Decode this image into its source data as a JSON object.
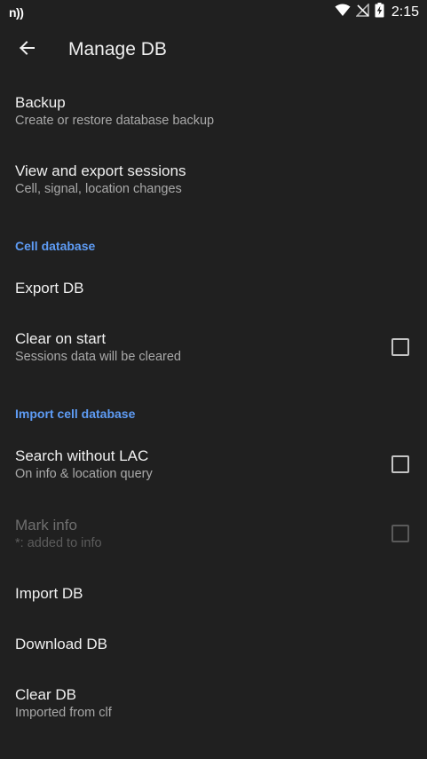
{
  "status_bar": {
    "carrier_glyph": "n))",
    "time": "2:15",
    "icons": [
      "wifi-icon",
      "no-signal-icon",
      "battery-charging-icon"
    ]
  },
  "app_bar": {
    "back_icon": "arrow-back-icon",
    "title": "Manage DB"
  },
  "items": {
    "backup": {
      "title": "Backup",
      "subtitle": "Create or restore database backup"
    },
    "sessions": {
      "title": "View and export sessions",
      "subtitle": "Cell, signal, location changes"
    },
    "export_db": {
      "title": "Export DB"
    },
    "clear_on_start": {
      "title": "Clear on start",
      "subtitle": "Sessions data will be cleared",
      "checked": false
    },
    "search_without_lac": {
      "title": "Search without LAC",
      "subtitle": "On info & location query",
      "checked": false
    },
    "mark_info": {
      "title": "Mark info",
      "subtitle": "*: added to info",
      "checked": false,
      "enabled": false
    },
    "import_db": {
      "title": "Import DB"
    },
    "download_db": {
      "title": "Download DB"
    },
    "clear_db": {
      "title": "Clear DB",
      "subtitle": "Imported from clf"
    }
  },
  "sections": {
    "cell_database": "Cell database",
    "import_cell_database": "Import cell database"
  },
  "colors": {
    "background": "#202020",
    "accent": "#5e9cf5",
    "text_primary": "#f0f0f0",
    "text_secondary": "#a9a9a9"
  }
}
